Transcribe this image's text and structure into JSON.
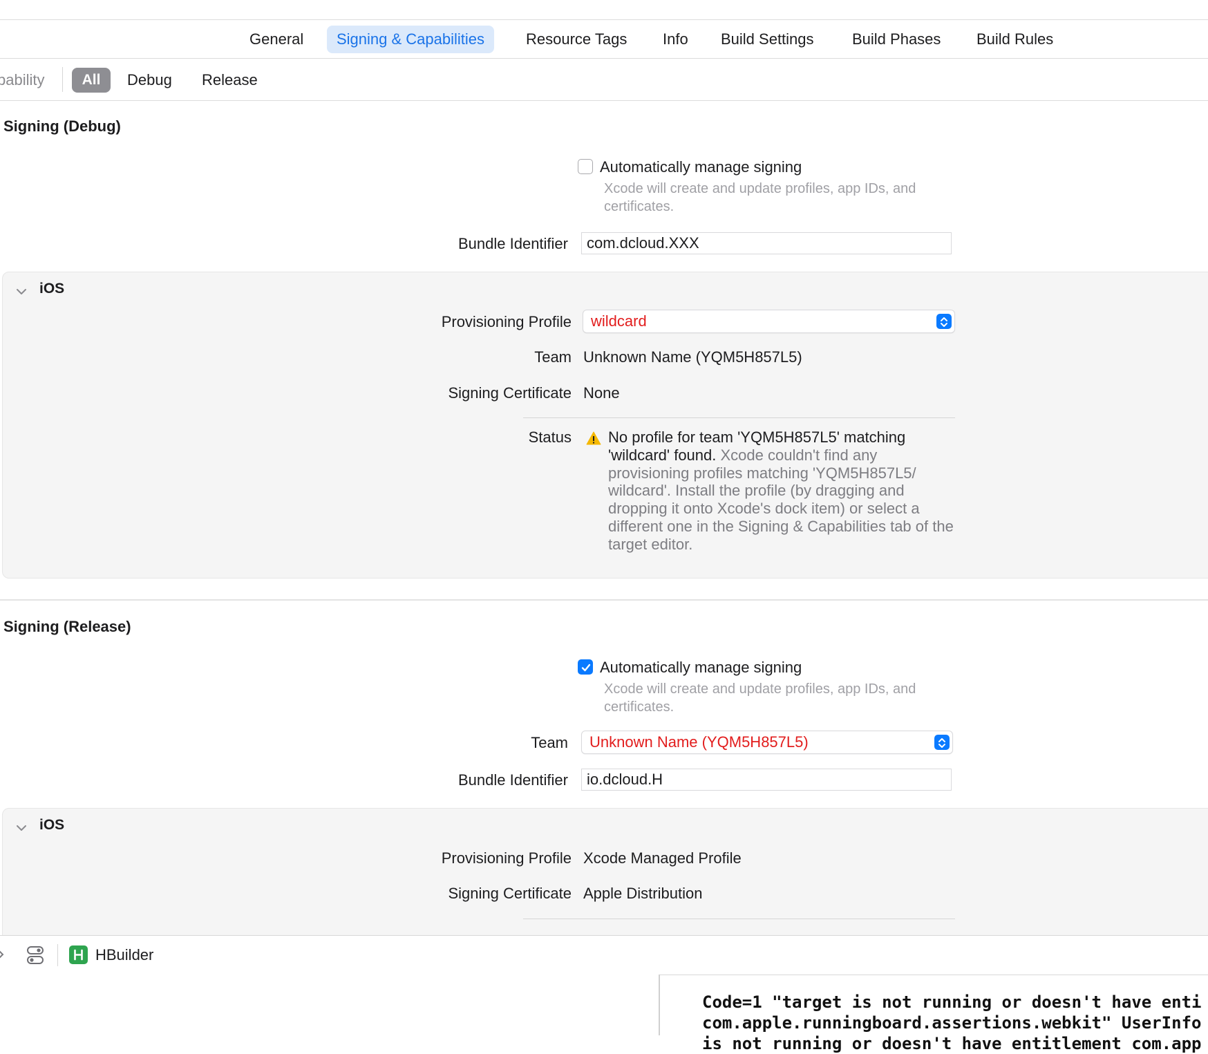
{
  "tabs": [
    "General",
    "Signing & Capabilities",
    "Resource Tags",
    "Info",
    "Build Settings",
    "Build Phases",
    "Build Rules"
  ],
  "active_tab": "Signing & Capabilities",
  "filter_bar": {
    "capability_partial": "pability",
    "filters": [
      "All",
      "Debug",
      "Release"
    ],
    "selected": "All"
  },
  "debug": {
    "title": "Signing (Debug)",
    "auto_manage_label": "Automatically manage signing",
    "auto_manage_checked": false,
    "auto_manage_hint": "Xcode will create and update profiles, app IDs, and certificates.",
    "bundle_id_label": "Bundle Identifier",
    "bundle_id_value": "com.dcloud.XXX",
    "ios": {
      "label": "iOS",
      "profile_label": "Provisioning Profile",
      "profile_value": "wildcard",
      "team_label": "Team",
      "team_value": "Unknown Name (YQM5H857L5)",
      "cert_label": "Signing Certificate",
      "cert_value": "None",
      "status_label": "Status",
      "status_bold": "No profile for team 'YQM5H857L5' matching 'wildcard' found.",
      "status_detail": "Xcode couldn't find any provisioning profiles matching 'YQM5H857L5/ wildcard'. Install the profile (by dragging and dropping it onto Xcode's dock item) or select a different one in the Signing & Capabilities tab of the target editor."
    }
  },
  "release": {
    "title": "Signing (Release)",
    "auto_manage_label": "Automatically manage signing",
    "auto_manage_checked": true,
    "auto_manage_hint": "Xcode will create and update profiles, app IDs, and certificates.",
    "team_label": "Team",
    "team_value": "Unknown Name (YQM5H857L5)",
    "bundle_id_label": "Bundle Identifier",
    "bundle_id_value": "io.dcloud.H",
    "ios": {
      "label": "iOS",
      "profile_label": "Provisioning Profile",
      "profile_value": "Xcode Managed Profile",
      "cert_label": "Signing Certificate",
      "cert_value": "Apple Distribution"
    }
  },
  "bottom_bar": {
    "scheme_name": "HBuilder"
  },
  "console": [
    "Code=1 \"target is not running or doesn't have enti",
    "com.apple.runningboard.assertions.webkit\" UserInfo",
    "is not running or doesn't have entitlement com.app"
  ],
  "colors": {
    "accent": "#0a7aff",
    "tab_active_bg": "#dbe9fb",
    "error_red": "#e21d1d",
    "warning_yellow": "#f5b800",
    "panel_bg": "#f5f5f5"
  },
  "icons": [
    "chevron-down-icon",
    "checkmark-icon",
    "popup-stepper-icon",
    "warning-icon",
    "toggle-icon",
    "hbuilder-app-icon"
  ]
}
